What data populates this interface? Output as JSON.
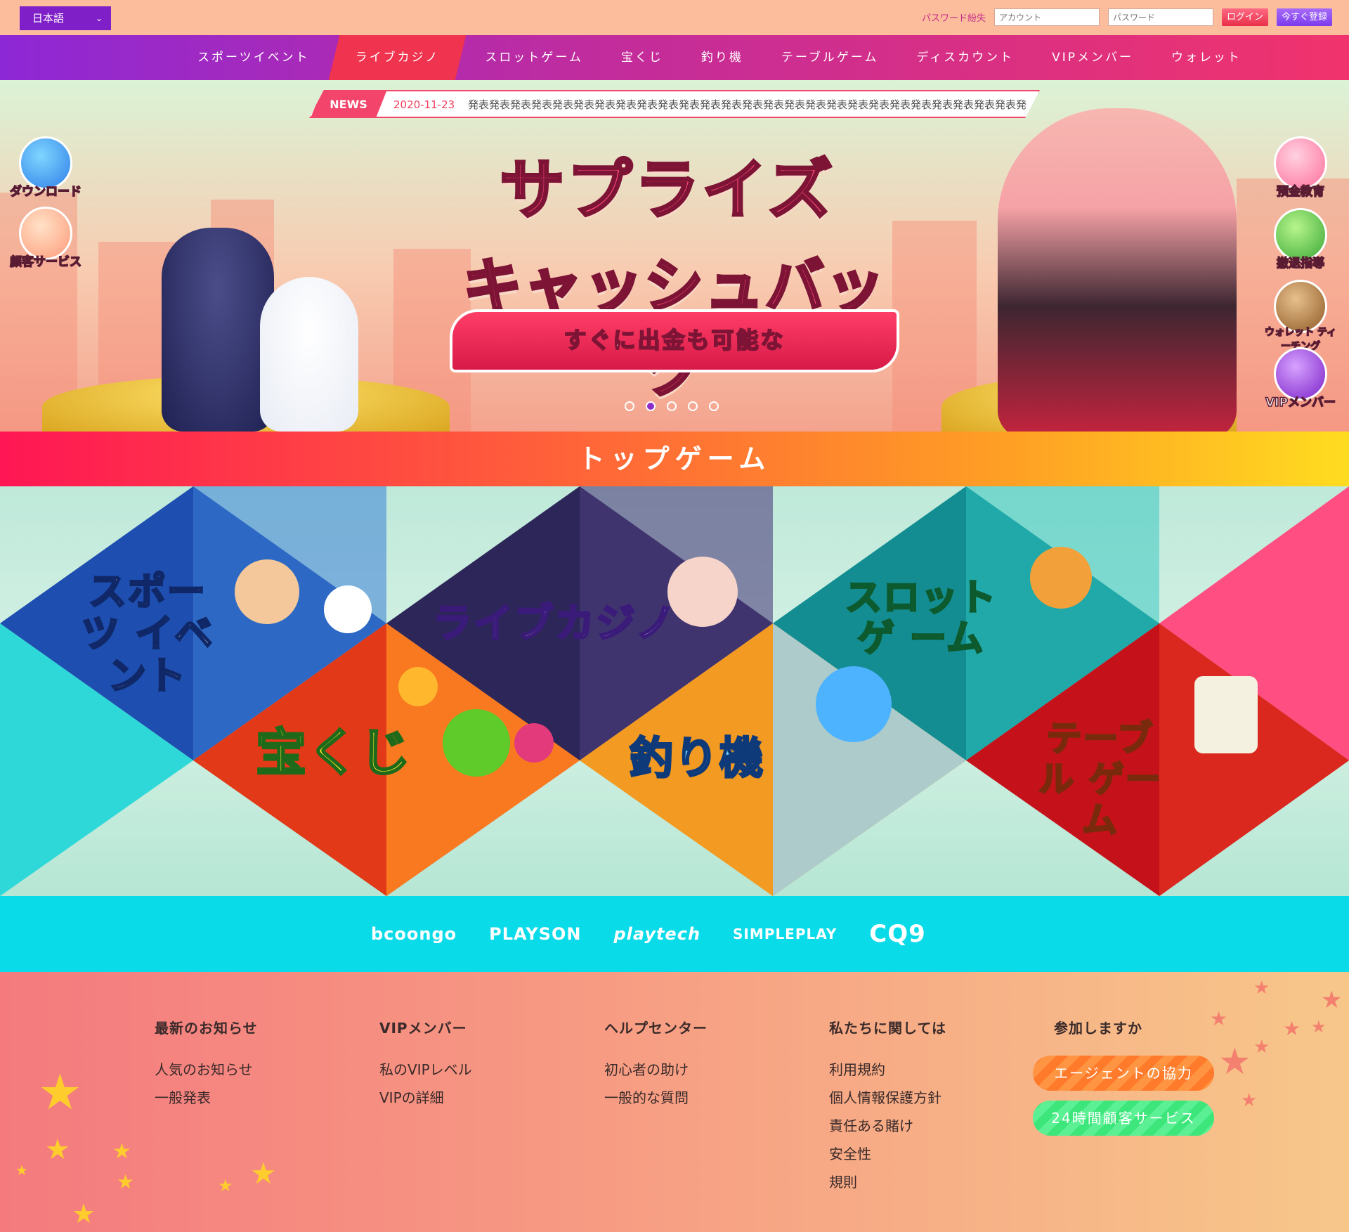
{
  "topbar": {
    "language": "日本語",
    "forgot_password": "パスワード紛失",
    "account_placeholder": "アカウント",
    "password_placeholder": "パスワード",
    "login_label": "ログイン",
    "register_label": "今すぐ登録"
  },
  "nav": {
    "items": [
      "スポーツイベント",
      "ライブカジノ",
      "スロットゲーム",
      "宝くじ",
      "釣り機",
      "テーブルゲーム",
      "ディスカウント",
      "VIPメンバー",
      "ウォレット"
    ],
    "active_index": 1
  },
  "news": {
    "tag": "NEWS",
    "date": "2020-11-23",
    "text": "発表発表発表発表発表発表発表発表発表発表発表発表発表発表発表発表発表発表発表発表発表発表発表発表発表発表発表発表発表発表発表発表発表発表発表"
  },
  "hero": {
    "title_line1": "サプライズ",
    "title_line2": "キャッシュバック",
    "ribbon": "すぐに出金も可能な",
    "slide_count": 5,
    "active_slide": 2
  },
  "side_left": [
    "ダウンロード",
    "顧客サービス"
  ],
  "side_right": [
    "預金教育",
    "撤退指導",
    "ウォレット ティーチング",
    "VIPメンバー"
  ],
  "top_games": {
    "title": "トップゲーム",
    "games": [
      {
        "label": "スポーツ イベント"
      },
      {
        "label": "ライブカジノ"
      },
      {
        "label": "スロットゲ ーム"
      },
      {
        "label": "宝くじ"
      },
      {
        "label": "釣り機"
      },
      {
        "label": "テーブル ゲーム"
      }
    ]
  },
  "providers": [
    "bcoongo",
    "PLAYSON",
    "playtech",
    "SIMPLEPLAY",
    "CQ9"
  ],
  "footer": {
    "col1": {
      "title": "最新のお知らせ",
      "links": [
        "人気のお知らせ",
        "一般発表"
      ]
    },
    "col2": {
      "title": "VIPメンバー",
      "links": [
        "私のVIPレベル",
        "VIPの詳細"
      ]
    },
    "col3": {
      "title": "ヘルプセンター",
      "links": [
        "初心者の助け",
        "一般的な質問"
      ]
    },
    "col4": {
      "title": "私たちに関しては",
      "links": [
        "利用規約",
        "個人情報保護方針",
        "責任ある賭け",
        "安全性",
        "規則"
      ]
    },
    "col5": {
      "title": "参加しますか",
      "buttons": [
        "エージェントの協力",
        "24時間顧客サービス"
      ]
    }
  },
  "colors": {
    "nav_active": "#f0334e",
    "accent_purple": "#7f1fc7",
    "provider_bar": "#0adbe8",
    "news_red": "#f3456b"
  }
}
